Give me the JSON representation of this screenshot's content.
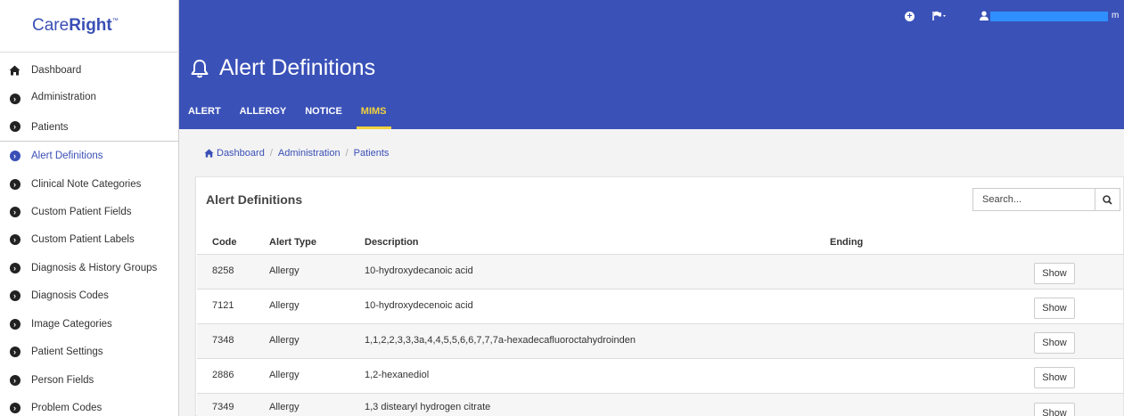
{
  "brand": {
    "name_regular": "Care",
    "name_bold": "Right",
    "tm": "™"
  },
  "sidebar": {
    "items": [
      {
        "label": "Dashboard",
        "icon": "home-icon"
      },
      {
        "label": "Administration",
        "icon": "chevron-circle-icon"
      },
      {
        "label": "Patients",
        "icon": "chevron-circle-icon"
      },
      {
        "label": "Alert Definitions",
        "icon": "chevron-circle-icon",
        "active": true
      },
      {
        "label": "Clinical Note Categories",
        "icon": "chevron-circle-icon"
      },
      {
        "label": "Custom Patient Fields",
        "icon": "chevron-circle-icon"
      },
      {
        "label": "Custom Patient Labels",
        "icon": "chevron-circle-icon"
      },
      {
        "label": "Diagnosis & History Groups",
        "icon": "chevron-circle-icon"
      },
      {
        "label": "Diagnosis Codes",
        "icon": "chevron-circle-icon"
      },
      {
        "label": "Image Categories",
        "icon": "chevron-circle-icon"
      },
      {
        "label": "Patient Settings",
        "icon": "chevron-circle-icon"
      },
      {
        "label": "Person Fields",
        "icon": "chevron-circle-icon"
      },
      {
        "label": "Problem Codes",
        "icon": "chevron-circle-icon"
      }
    ]
  },
  "header": {
    "title": "Alert Definitions",
    "user_suffix": "m",
    "tabs": [
      {
        "label": "ALERT"
      },
      {
        "label": "ALLERGY"
      },
      {
        "label": "NOTICE"
      },
      {
        "label": "MIMS",
        "active": true
      }
    ]
  },
  "breadcrumb": [
    "Dashboard",
    "Administration",
    "Patients"
  ],
  "panel": {
    "title": "Alert Definitions",
    "search_placeholder": "Search...",
    "columns": [
      "Code",
      "Alert Type",
      "Description",
      "Ending"
    ],
    "rows": [
      {
        "code": "8258",
        "type": "Allergy",
        "description": "10-hydroxydecanoic acid",
        "ending": "",
        "action": "Show"
      },
      {
        "code": "7121",
        "type": "Allergy",
        "description": "10-hydroxydecenoic acid",
        "ending": "",
        "action": "Show"
      },
      {
        "code": "7348",
        "type": "Allergy",
        "description": "1,1,2,2,3,3,3a,4,4,5,5,6,6,7,7,7a-hexadecafluoroctahydroinden",
        "ending": "",
        "action": "Show"
      },
      {
        "code": "2886",
        "type": "Allergy",
        "description": "1,2-hexanediol",
        "ending": "",
        "action": "Show"
      },
      {
        "code": "7349",
        "type": "Allergy",
        "description": "1,3 distearyl hydrogen citrate",
        "ending": "",
        "action": "Show"
      }
    ]
  },
  "colors": {
    "header_blue": "#3a51b8",
    "active_tab": "#f2d23c",
    "link_blue": "#3a4fb5"
  }
}
